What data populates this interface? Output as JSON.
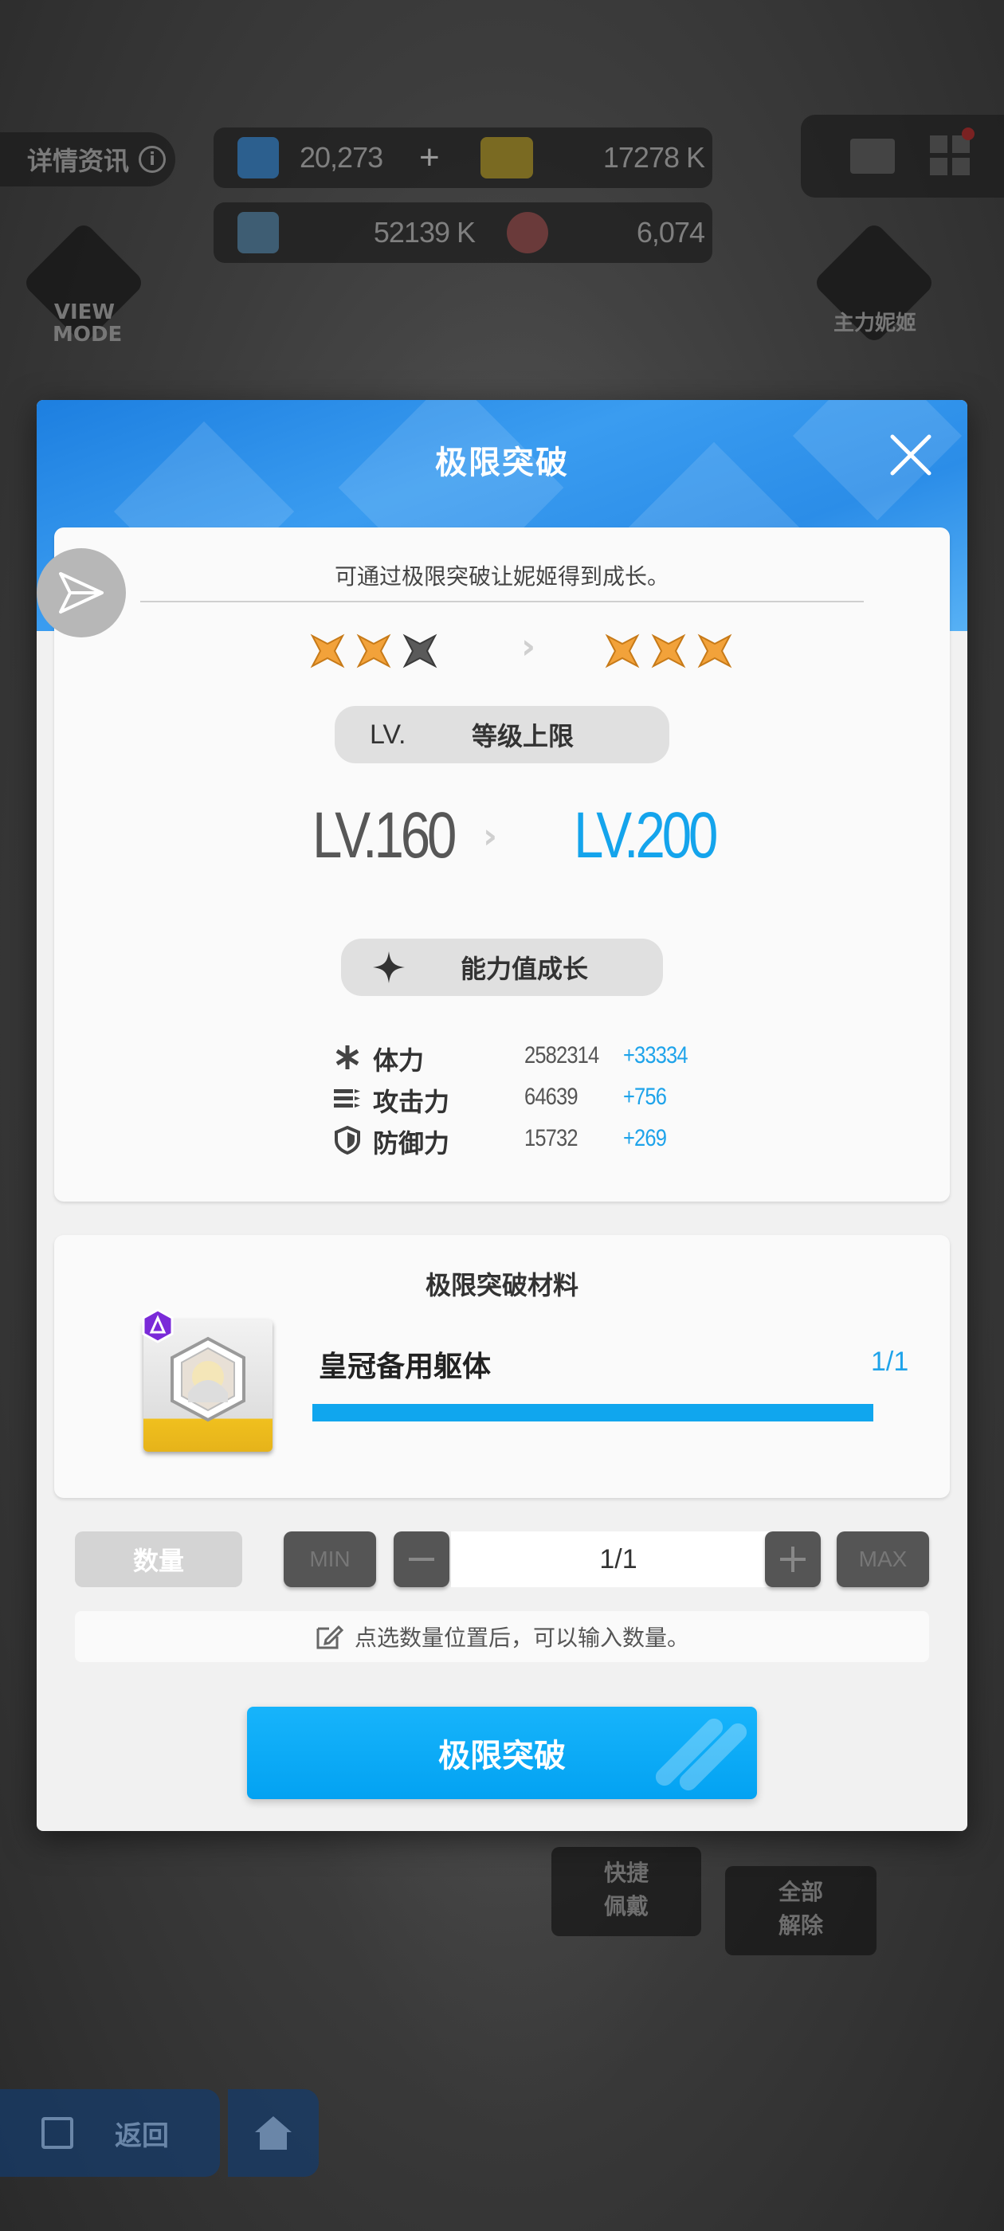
{
  "background": {
    "detail_tag": "详情资讯",
    "detail_info_glyph": "i",
    "resources": [
      {
        "value": "20,273",
        "icon": "gem-icon"
      },
      {
        "value": "17278 K",
        "icon": "credit-card-icon"
      },
      {
        "value": "52139 K",
        "icon": "battle-data-icon"
      },
      {
        "value": "6,074",
        "icon": "core-dust-icon"
      }
    ],
    "plus_glyph": "+",
    "view_mode_label": "VIEW\nMODE",
    "main_nikke_label": "主力妮姬",
    "quick_equip": "快捷\n佩戴",
    "remove_all": "全部\n解除",
    "back_label": "返回"
  },
  "modal": {
    "title": "极限突破",
    "description": "可通过极限突破让妮姬得到成长。",
    "stars_before": {
      "filled": 2,
      "total": 3
    },
    "stars_after": {
      "filled": 3,
      "total": 3
    },
    "level_header": {
      "prefix": "LV.",
      "label": "等级上限"
    },
    "level_from": "LV.160",
    "level_to": "LV.200",
    "stat_header": "能力值成长",
    "stats": [
      {
        "name": "体力",
        "value": "2582314",
        "increase": "+33334",
        "icon": "hp-asterisk-icon"
      },
      {
        "name": "攻击力",
        "value": "64639",
        "increase": "+756",
        "icon": "attack-ammo-icon"
      },
      {
        "name": "防御力",
        "value": "15732",
        "increase": "+269",
        "icon": "defense-shield-icon"
      }
    ],
    "materials_title": "极限突破材料",
    "material": {
      "name": "皇冠备用躯体",
      "count": "1/1",
      "progress": 1.0
    },
    "quantity": {
      "label": "数量",
      "min_label": "MIN",
      "max_label": "MAX",
      "value": "1/1"
    },
    "hint": "点选数量位置后，可以输入数量。",
    "confirm_label": "极限突破"
  },
  "colors": {
    "accent": "#10a6ee",
    "header_blue": "#2b8de8",
    "star_gold": "#f2a23a",
    "star_empty": "#5a5a5a"
  }
}
